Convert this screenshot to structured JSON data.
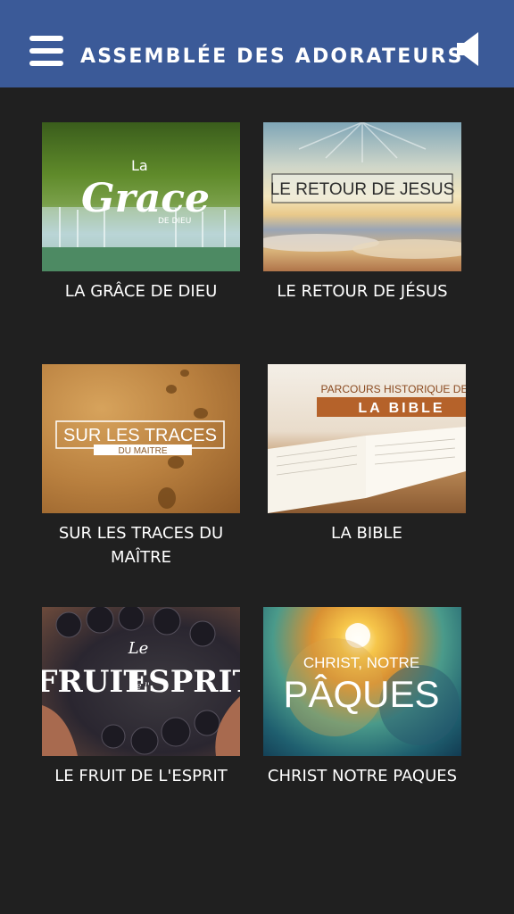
{
  "header": {
    "title": "ASSEMBLÉE DES ADORATEURS",
    "menu_icon": "hamburger-menu-icon",
    "sound_icon": "speaker-icon",
    "bar_color": "#3b5a98"
  },
  "grid": {
    "items": [
      {
        "caption": "LA GRÂCE DE DIEU",
        "thumb_text": [
          "La",
          "Grace",
          "DE DIEU"
        ]
      },
      {
        "caption": "LE RETOUR DE JÉSUS",
        "thumb_text": [
          "LE RETOUR DE JESUS"
        ]
      },
      {
        "caption": "SUR LES TRACES DU MAÎTRE",
        "thumb_text": [
          "SUR LES TRACES",
          "DU MAITRE"
        ]
      },
      {
        "caption": "LA BIBLE",
        "thumb_text": [
          "PARCOURS HISTORIQUE DE",
          "LA BIBLE"
        ]
      },
      {
        "caption": "LE FRUIT DE L'ESPRIT",
        "thumb_text": [
          "Le",
          "FRUIT",
          "de l'",
          "ESPRIT"
        ]
      },
      {
        "caption": "CHRIST NOTRE PAQUES",
        "thumb_text": [
          "CHRIST, NOTRE",
          "PÂQUES"
        ]
      }
    ]
  },
  "colors": {
    "background": "#202020",
    "text": "#ffffff"
  }
}
